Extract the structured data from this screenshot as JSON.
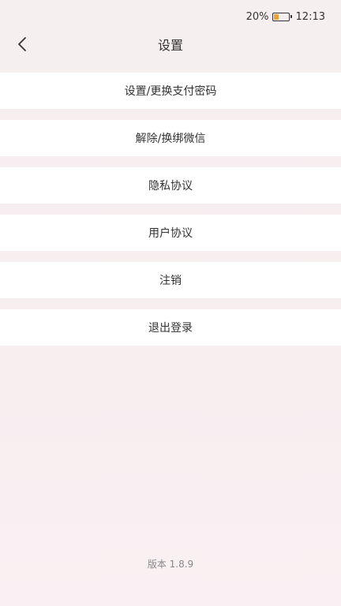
{
  "status_bar": {
    "battery_percent": "20%",
    "time": "12:13"
  },
  "header": {
    "title": "设置",
    "back_icon": "chevron-left-icon"
  },
  "menu": {
    "items": [
      {
        "label": "设置/更换支付密码"
      },
      {
        "label": "解除/换绑微信"
      },
      {
        "label": "隐私协议"
      },
      {
        "label": "用户协议"
      },
      {
        "label": "注销"
      },
      {
        "label": "退出登录"
      }
    ]
  },
  "footer": {
    "version": "版本 1.8.9"
  },
  "colors": {
    "background": "#f7eef0",
    "item_background": "#ffffff",
    "battery_fill": "#e7a23a"
  }
}
